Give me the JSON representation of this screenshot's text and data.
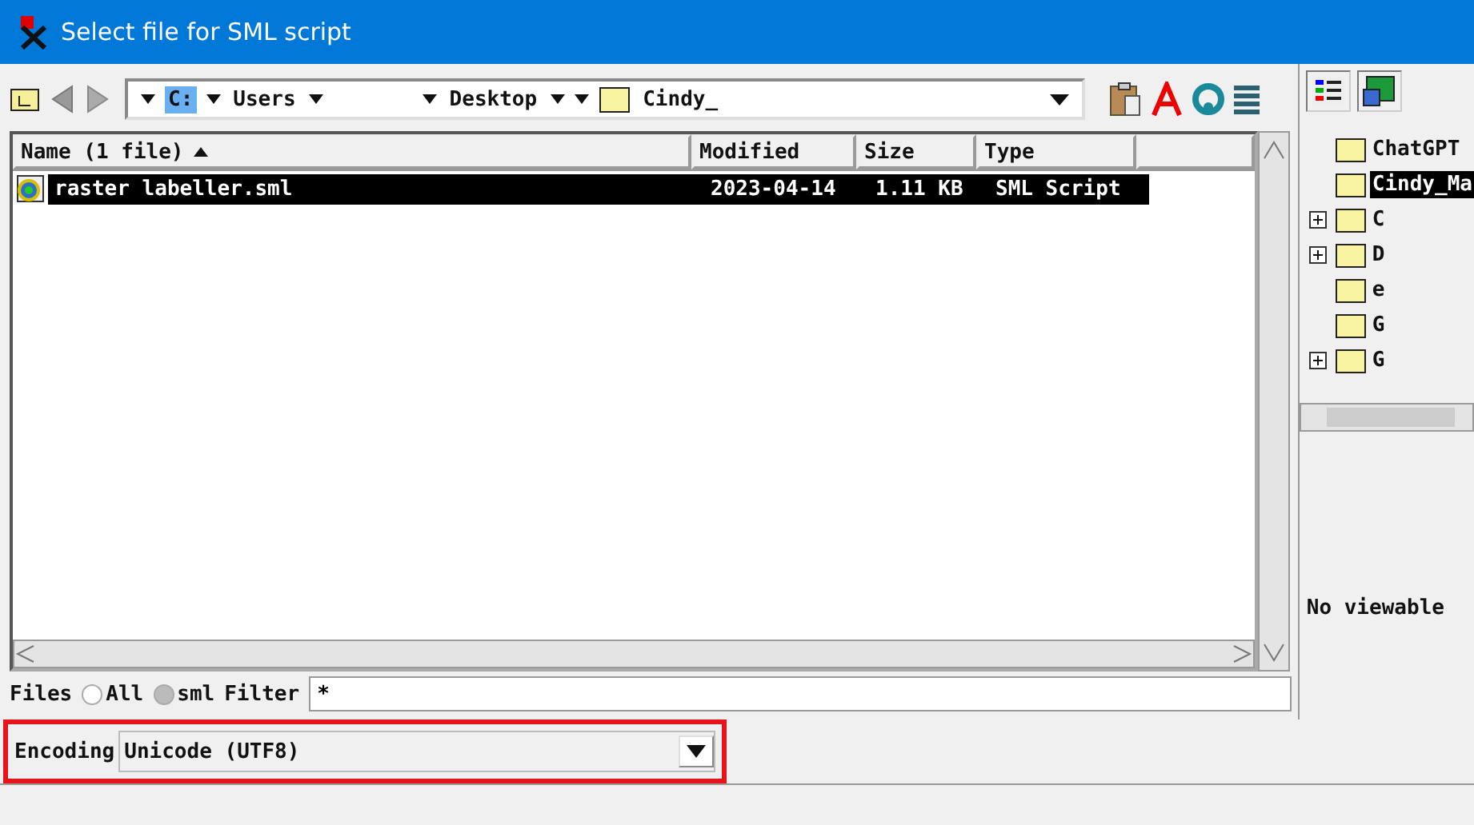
{
  "window": {
    "title": "Select file for SML script"
  },
  "path": {
    "segments": [
      {
        "label": "C:",
        "kind": "drive",
        "selected": true
      },
      {
        "label": "Users",
        "kind": "dir",
        "selected": false
      },
      {
        "label": "Desktop",
        "kind": "dir",
        "selected": false
      },
      {
        "label": "Cindy_",
        "kind": "folder",
        "selected": false
      }
    ]
  },
  "table": {
    "columns": [
      {
        "label": "Name  (1 file)",
        "sorted": true
      },
      {
        "label": "Modified",
        "sorted": false
      },
      {
        "label": "Size",
        "sorted": false
      },
      {
        "label": "Type",
        "sorted": false
      }
    ],
    "rows": [
      {
        "name": "raster labeller.sml",
        "modified": "2023-04-14",
        "size": "1.11 KB",
        "type": "SML Script",
        "selected": true
      }
    ]
  },
  "tree": {
    "items": [
      {
        "label": "ChatGPT",
        "expandable": false,
        "selected": false
      },
      {
        "label": "Cindy_Ma",
        "expandable": false,
        "selected": true
      },
      {
        "label": "C",
        "expandable": true,
        "selected": false
      },
      {
        "label": "D",
        "expandable": true,
        "selected": false
      },
      {
        "label": "e",
        "expandable": false,
        "selected": false
      },
      {
        "label": "G",
        "expandable": false,
        "selected": false
      },
      {
        "label": "G",
        "expandable": true,
        "selected": false
      }
    ]
  },
  "preview": {
    "text": "No viewable"
  },
  "files": {
    "label": "Files",
    "options": [
      {
        "label": "All",
        "selected": false
      },
      {
        "label": "sml",
        "selected": true
      }
    ],
    "filter_label": "Filter",
    "filter_value": "*"
  },
  "encoding": {
    "label": "Encoding",
    "value": "Unicode (UTF8)",
    "highlighted": true
  }
}
